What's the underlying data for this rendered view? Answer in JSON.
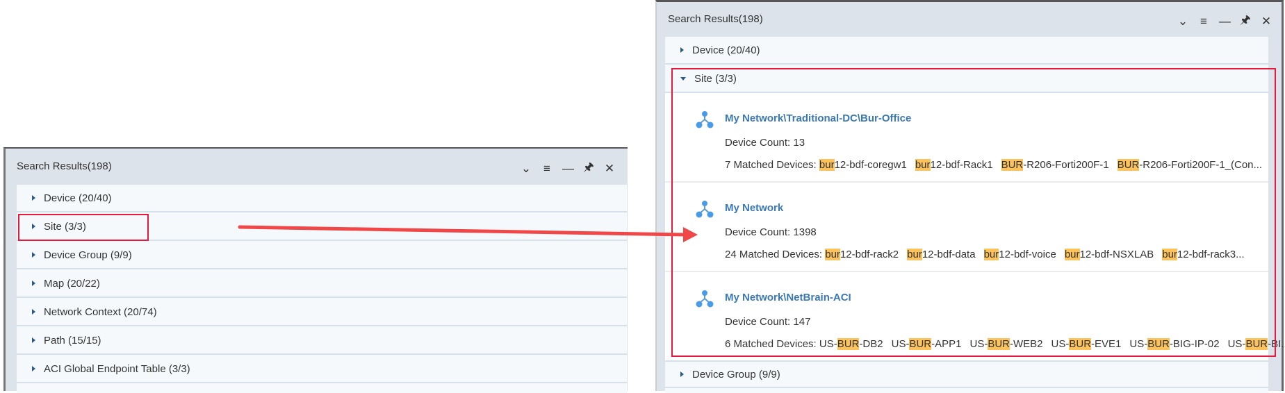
{
  "left_panel": {
    "title": "Search Results(198)",
    "categories": [
      {
        "label": "Device (20/40)"
      },
      {
        "label": "Site (3/3)"
      },
      {
        "label": "Device Group (9/9)"
      },
      {
        "label": "Map (20/22)"
      },
      {
        "label": "Network Context (20/74)"
      },
      {
        "label": "Path (15/15)"
      },
      {
        "label": "ACI Global Endpoint Table (3/3)"
      }
    ]
  },
  "right_panel": {
    "title": "Search Results(198)",
    "categories_before": [
      {
        "label": "Device (20/40)"
      }
    ],
    "expanded": {
      "label": "Site (3/3)",
      "sites": [
        {
          "name": "My Network\\Traditional-DC\\Bur-Office",
          "device_count": "Device Count: 13",
          "matched_label": "7 Matched Devices: ",
          "devices": [
            {
              "match": "bur",
              "rest": "12-bdf-coregw1"
            },
            {
              "match": "bur",
              "rest": "12-bdf-Rack1"
            },
            {
              "match": "BUR",
              "rest": "-R206-Forti200F-1"
            },
            {
              "match": "BUR",
              "rest": "-R206-Forti200F-1_(Con..."
            }
          ]
        },
        {
          "name": "My Network",
          "device_count": "Device Count: 1398",
          "matched_label": "24 Matched Devices: ",
          "devices": [
            {
              "match": "bur",
              "rest": "12-bdf-rack2"
            },
            {
              "match": "bur",
              "rest": "12-bdf-data"
            },
            {
              "match": "bur",
              "rest": "12-bdf-voice"
            },
            {
              "match": "bur",
              "rest": "12-bdf-NSXLAB"
            },
            {
              "match": "bur",
              "rest": "12-bdf-rack3..."
            }
          ]
        },
        {
          "name": "My Network\\NetBrain-ACI",
          "device_count": "Device Count: 147",
          "matched_label": "6 Matched Devices: ",
          "devices": [
            {
              "pre": "US-",
              "match": "BUR",
              "rest": "-DB2"
            },
            {
              "pre": "US-",
              "match": "BUR",
              "rest": "-APP1"
            },
            {
              "pre": "US-",
              "match": "BUR",
              "rest": "-WEB2"
            },
            {
              "pre": "US-",
              "match": "BUR",
              "rest": "-EVE1"
            },
            {
              "pre": "US-",
              "match": "BUR",
              "rest": "-BIG-IP-02"
            },
            {
              "pre": "US-",
              "match": "BUR",
              "rest": "-BI..."
            }
          ]
        }
      ]
    },
    "categories_after": [
      {
        "label": "Device Group (9/9)"
      }
    ]
  },
  "header_icons": [
    "chevron-down-icon",
    "list-icon",
    "minimize-icon",
    "pin-icon",
    "close-icon"
  ],
  "colors": {
    "highlight": "#fdc35a",
    "annotation": "#e8193c",
    "link": "#3a78b4",
    "arrow": "#f04848"
  }
}
